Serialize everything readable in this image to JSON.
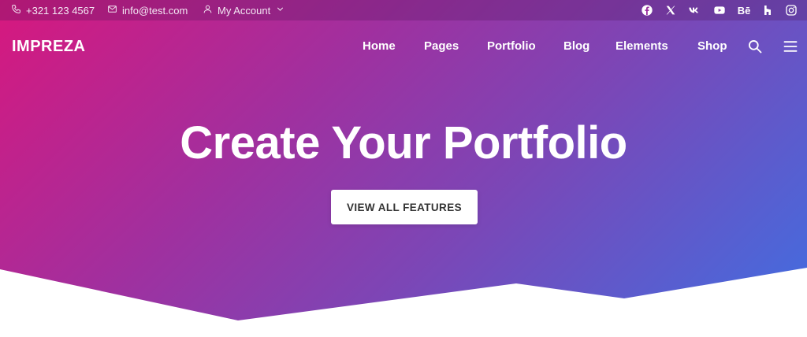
{
  "topbar": {
    "phone": "+321 123 4567",
    "email": "info@test.com",
    "account_label": "My Account",
    "social_icons": [
      "facebook-icon",
      "x-icon",
      "vk-icon",
      "youtube-icon",
      "behance-icon",
      "houzz-icon",
      "instagram-icon"
    ],
    "behance_text": "Bē"
  },
  "header": {
    "logo": "IMPREZA",
    "nav": [
      "Home",
      "Pages",
      "Portfolio",
      "Blog",
      "Elements",
      "Shop"
    ]
  },
  "hero": {
    "title": "Create Your Portfolio",
    "cta_label": "VIEW ALL FEATURES"
  },
  "colors": {
    "gradient_start": "#d7187e",
    "gradient_end": "#3f6fe2",
    "button_bg": "#ffffff",
    "button_text": "#333333"
  }
}
